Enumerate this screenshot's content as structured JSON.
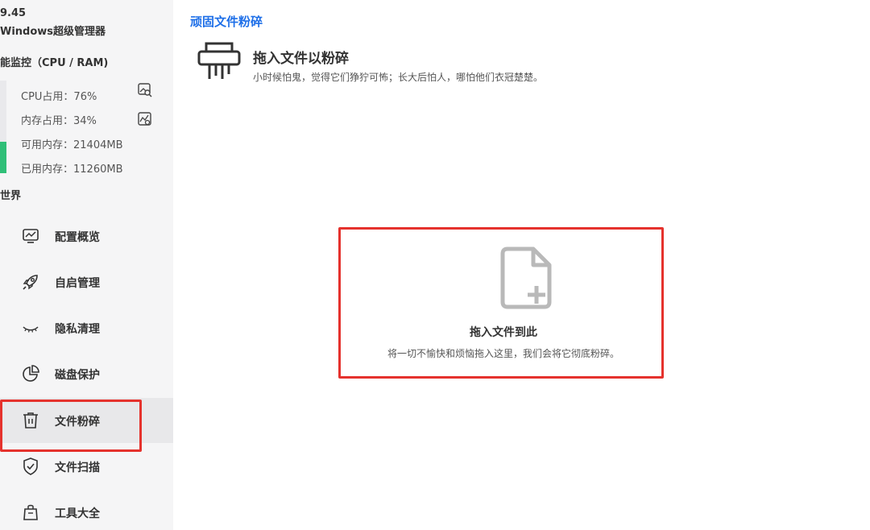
{
  "sidebar": {
    "version": "9.45",
    "app_name": "Windows超级管理器",
    "perf_title": "能监控（CPU / RAM)",
    "cpu_label": "CPU占用：76%",
    "mem_label": "内存占用：34%",
    "avail_label": "可用内存：21404MB",
    "used_label": "已用内存：11260MB",
    "mem_level": 0.34,
    "section_title": "世界",
    "items": [
      {
        "label": "配置概览",
        "icon": "monitor-chart-icon"
      },
      {
        "label": "自启管理",
        "icon": "rocket-icon"
      },
      {
        "label": "隐私清理",
        "icon": "closed-eye-icon"
      },
      {
        "label": "磁盘保护",
        "icon": "pie-chart-icon"
      },
      {
        "label": "文件粉碎",
        "icon": "trash-icon",
        "active": true
      },
      {
        "label": "文件扫描",
        "icon": "shield-check-icon"
      },
      {
        "label": "工具大全",
        "icon": "bag-icon"
      }
    ]
  },
  "main": {
    "title": "顽固文件粉碎",
    "header_title": "拖入文件以粉碎",
    "header_subtitle": "小时候怕鬼，觉得它们狰狞可怖；长大后怕人，哪怕他们衣冠楚楚。",
    "drop_title": "拖入文件到此",
    "drop_subtitle": "将一切不愉快和烦恼拖入这里，我们会将它彻底粉碎。"
  },
  "colors": {
    "accent": "#1e6fe8",
    "highlight": "#e5322d",
    "bar_fill": "#2fbf78",
    "active_bg": "#e8e8ea"
  }
}
